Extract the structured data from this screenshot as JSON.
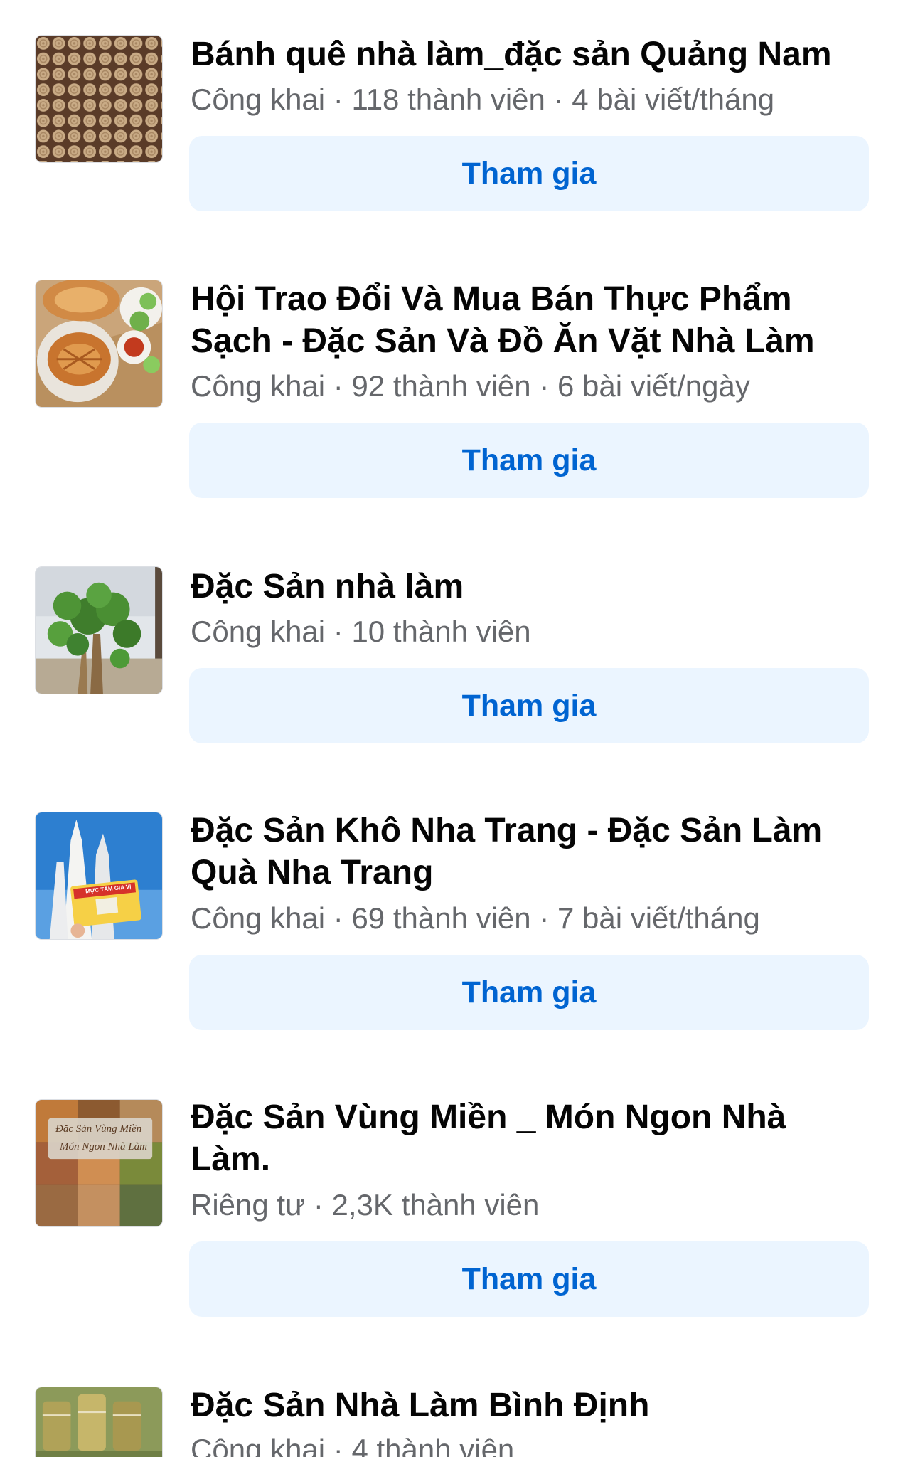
{
  "groups": [
    {
      "title": "Bánh quê nhà làm_đặc sản Quảng Nam",
      "meta": "Công khai · 118 thành viên · 4 bài viết/tháng",
      "button": "Tham gia"
    },
    {
      "title": "Hội Trao Đổi Và Mua Bán Thực Phẩm Sạch - Đặc Sản Và Đồ Ăn Vặt Nhà Làm",
      "meta": "Công khai · 92 thành viên · 6 bài viết/ngày",
      "button": "Tham gia"
    },
    {
      "title": "Đặc Sản nhà làm",
      "meta": "Công khai · 10 thành viên",
      "button": "Tham gia"
    },
    {
      "title": "Đặc Sản Khô Nha Trang - Đặc Sản Làm Quà Nha Trang",
      "meta": "Công khai · 69 thành viên · 7 bài viết/tháng",
      "button": "Tham gia",
      "thumb_text": "MỰC TẨM GIA VỊ"
    },
    {
      "title": "Đặc Sản Vùng Miền _ Món Ngon Nhà Làm.",
      "meta": "Riêng tư · 2,3K thành viên",
      "button": "Tham gia",
      "thumb_text_1": "Đặc Sản Vùng Miền",
      "thumb_text_2": "Món Ngon Nhà Làm"
    },
    {
      "title": "Đặc Sản Nhà Làm Bình Định",
      "meta": "Công khai · 4 thành viên"
    }
  ],
  "colors": {
    "button_bg": "#ebf5ff",
    "button_text": "#0064d1",
    "title_text": "#050505",
    "meta_text": "#65676b"
  }
}
